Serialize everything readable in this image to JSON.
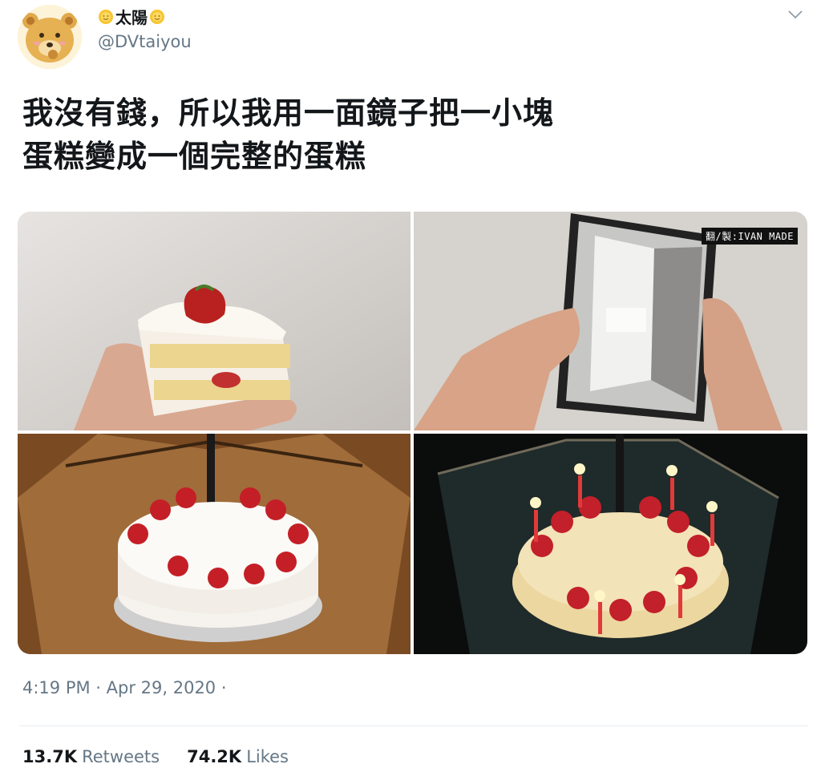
{
  "user": {
    "display_name": "太陽",
    "handle": "@DVtaiyou",
    "avatar_icon": "bear-avatar-icon",
    "name_emoji_left": "sun-icon",
    "name_emoji_right": "sun-icon"
  },
  "tweet": {
    "text_line_1": "我沒有錢，所以我用一面鏡子把一小塊",
    "text_line_2": "蛋糕變成一個完整的蛋糕"
  },
  "media": {
    "watermark": "翻/製:IVAN MADE",
    "photos": [
      "strawberry-shortcake-slice-photo",
      "hand-holding-folding-mirror-photo",
      "mirrored-full-cake-photo",
      "mirrored-cake-with-candles-photo"
    ]
  },
  "meta": {
    "timestamp": "4:19 PM · Apr 29, 2020 ·"
  },
  "stats": {
    "retweets_count": "13.7K",
    "retweets_label": "Retweets",
    "likes_count": "74.2K",
    "likes_label": "Likes"
  },
  "colors": {
    "text_primary": "#14171a",
    "text_secondary": "#657786",
    "divider": "#e6ecf0"
  }
}
